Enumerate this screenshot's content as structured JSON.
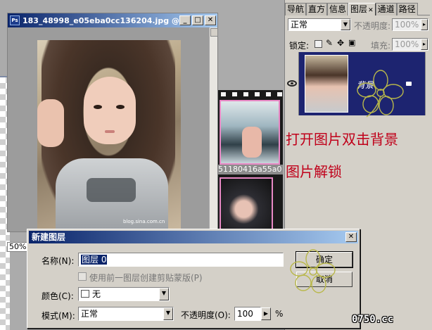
{
  "image_window": {
    "title": "183_48998_e05eba0cc136204.jpg @ ...",
    "app_icon": "ps-icon",
    "photo_watermark": "blog.sina.com.cn",
    "zoom": "50%"
  },
  "background_doc": {
    "caption": "51180416a55a0"
  },
  "layers_panel": {
    "tabs": [
      {
        "label": "导航"
      },
      {
        "label": "直方"
      },
      {
        "label": "信息"
      },
      {
        "label": "图层",
        "active": true
      },
      {
        "label": "通道"
      },
      {
        "label": "路径"
      }
    ],
    "blend_mode": "正常",
    "opacity_label": "不透明度:",
    "opacity_value": "100%",
    "lock_label": "锁定:",
    "fill_label": "填充:",
    "fill_value": "100%",
    "layer": {
      "name": "背景"
    }
  },
  "instructions": {
    "line1": "打开图片双击背景",
    "line2": "图片解锁"
  },
  "dialog": {
    "title": "新建图层",
    "name_label": "名称(N):",
    "name_value": "图层 0",
    "clip_checkbox_label": "使用前一图层创建剪贴蒙版(P)",
    "clip_checked": false,
    "color_label": "颜色(C):",
    "color_value": "无",
    "mode_label": "模式(M):",
    "mode_value": "正常",
    "opacity_label": "不透明度(O):",
    "opacity_value": "100",
    "opacity_unit": "%",
    "ok_label": "确定",
    "cancel_label": "取消"
  },
  "site_logo": "0750.cc",
  "colors": {
    "title_bar": "#0a246a",
    "instruction_red": "#c0001a",
    "layer_selected": "#1d2470"
  }
}
